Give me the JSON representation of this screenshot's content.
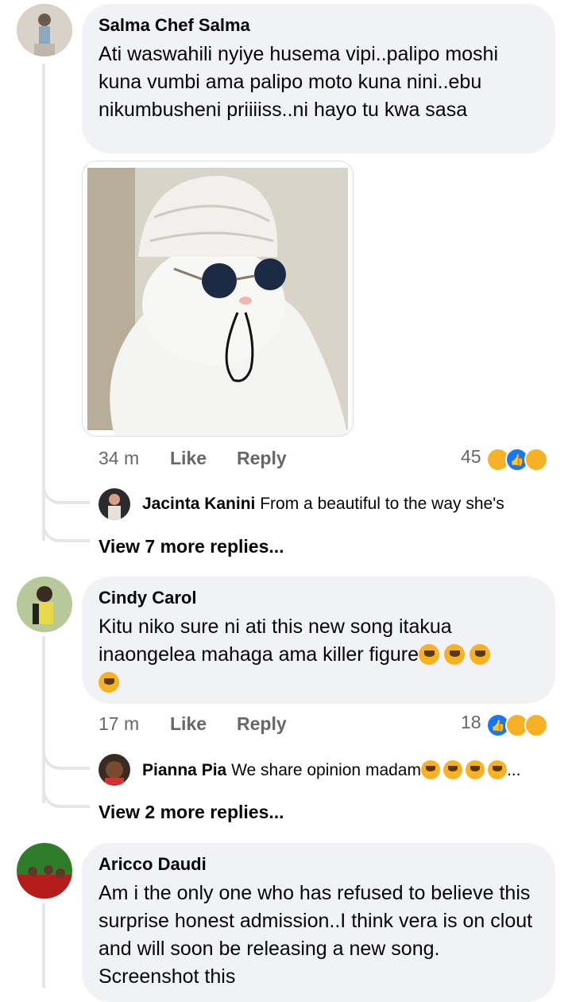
{
  "comments": [
    {
      "author": "Salma Chef Salma",
      "text": "Ati waswahili nyiye husema vipi..palipo moshi kuna vumbi ama palipo moto kuna nini..ebu nikumbusheni priiiiss..ni hayo tu kwa sasa",
      "has_image": true,
      "time": "34 m",
      "like_label": "Like",
      "reply_label": "Reply",
      "reaction_count": "45",
      "reactions": [
        "haha-icon",
        "like-icon",
        "wow-icon"
      ],
      "reply_preview": {
        "author": "Jacinta Kanini",
        "text": "From a beautiful to the way she's"
      },
      "view_more": "View 7 more replies..."
    },
    {
      "author": "Cindy Carol",
      "text": "Kitu niko sure ni ati this new song itakua inaongelea mahaga ama killer figure",
      "time": "17 m",
      "like_label": "Like",
      "reply_label": "Reply",
      "reaction_count": "18",
      "reactions": [
        "like-icon",
        "haha-icon",
        "wow-icon"
      ],
      "reply_preview": {
        "author": "Pianna Pia",
        "text": "We share opinion madam",
        "ellipsis": "..."
      },
      "view_more": "View 2 more replies..."
    },
    {
      "author": "Aricco Daudi",
      "text": "Am i the only one who has refused to believe this surprise honest admission..I think vera is on clout and will soon be releasing a new song. Screenshot this"
    }
  ],
  "colors": {
    "bubble": "#f0f2f5",
    "meta": "#65676b",
    "like_blue": "#1877f2",
    "haha_yellow": "#f7b125"
  }
}
